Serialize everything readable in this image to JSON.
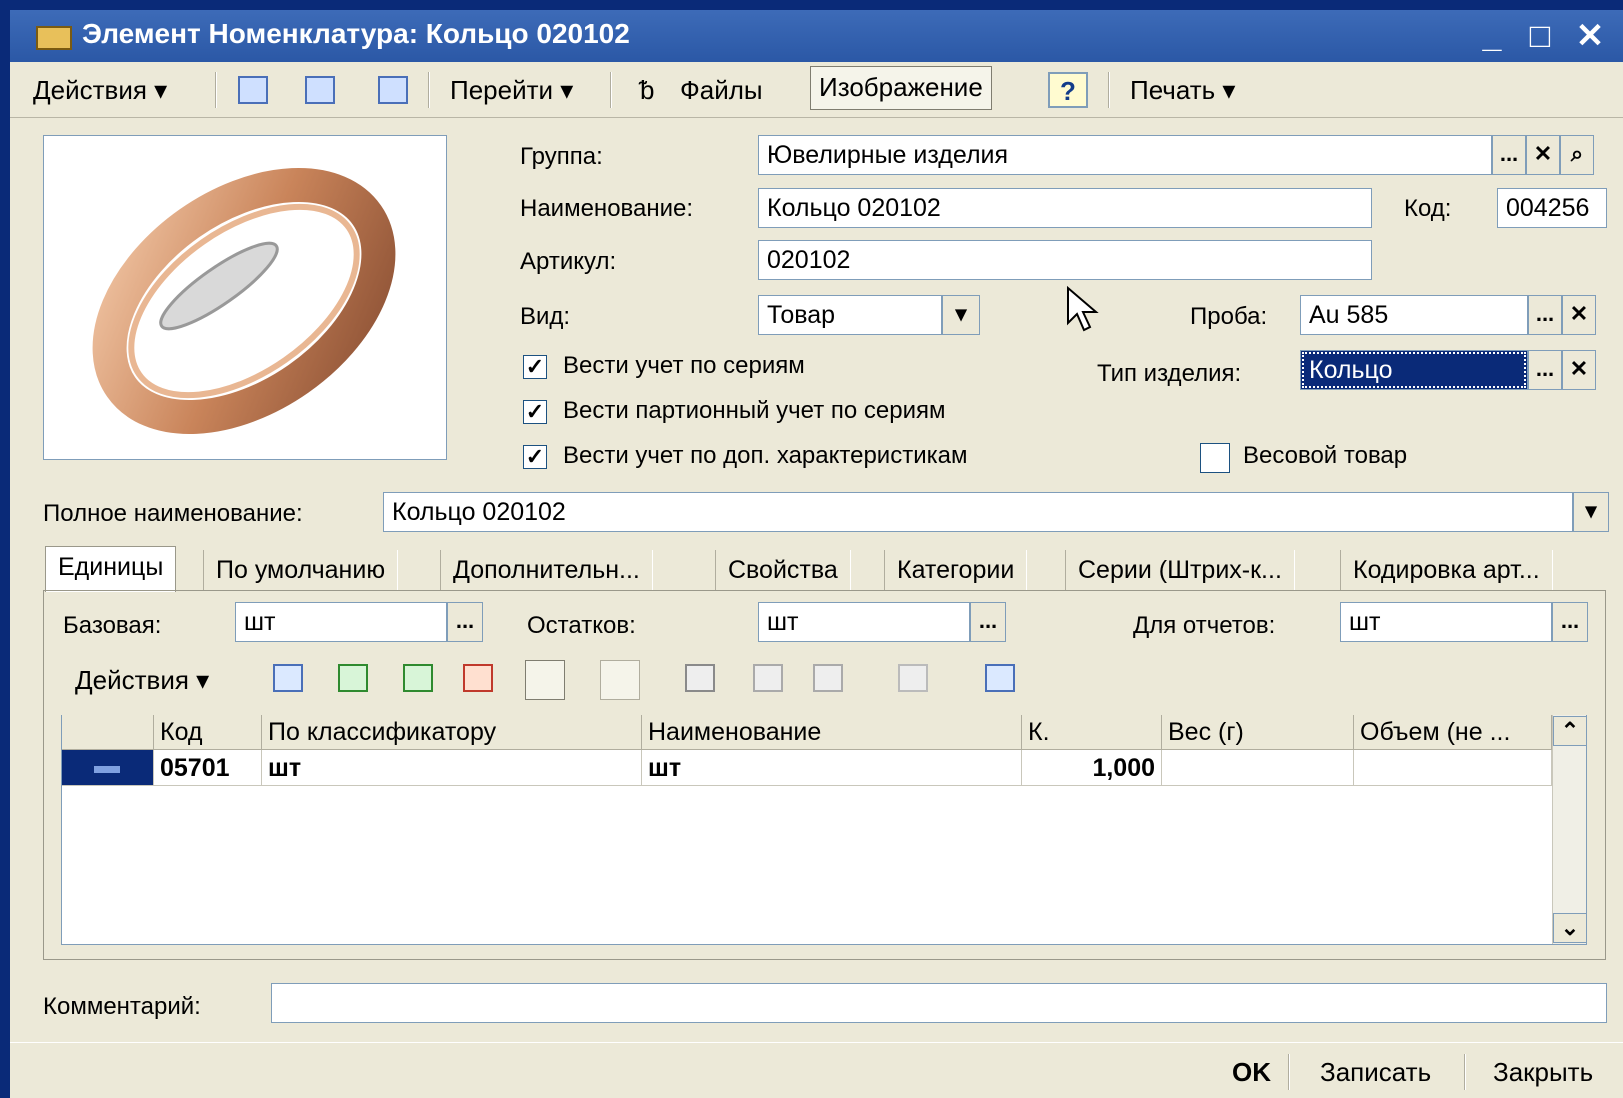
{
  "window": {
    "title": "Элемент Номенклатура: Кольцо 020102",
    "minimize": "_",
    "maximize": "□",
    "close": "✕"
  },
  "toolbar": {
    "actions": "Действия ▾",
    "goto": "Перейти ▾",
    "files": "Файлы",
    "image": "Изображение",
    "help": "?",
    "print": "Печать ▾"
  },
  "form": {
    "group_label": "Группа:",
    "group_value": "Ювелирные изделия",
    "name_label": "Наименование:",
    "name_value": "Кольцо 020102",
    "code_label": "Код:",
    "code_value": "004256",
    "article_label": "Артикул:",
    "article_value": "020102",
    "kind_label": "Вид:",
    "kind_value": "Товар",
    "assay_label": "Проба:",
    "assay_value": "Au 585",
    "product_type_label": "Тип изделия:",
    "product_type_value": "Кольцо",
    "cb_series": "Вести учет по сериям",
    "cb_batch_series": "Вести партионный учет по сериям",
    "cb_extra_chars": "Вести учет по доп.  характеристикам",
    "cb_weight": "Весовой товар",
    "fullname_label": "Полное наименование:",
    "fullname_value": "Кольцо 020102",
    "comment_label": "Комментарий:"
  },
  "tabs": [
    "Единицы",
    "По умолчанию",
    "Дополнительн...",
    "Свойства",
    "Категории",
    "Серии (Штрих-к...",
    "Кодировка арт..."
  ],
  "units": {
    "base_label": "Базовая:",
    "base_value": "шт",
    "rest_label": "Остатков:",
    "rest_value": "шт",
    "report_label": "Для отчетов:",
    "report_value": "шт",
    "actions": "Действия ▾"
  },
  "table": {
    "headers": [
      "Код",
      "По классификатору",
      "Наименование",
      "К.",
      "Вес (г)",
      "Объем (не ..."
    ],
    "rows": [
      {
        "code": "05701",
        "classifier": "шт",
        "name": "шт",
        "k": "1,000",
        "weight": "",
        "volume": ""
      }
    ]
  },
  "footer": {
    "ok": "OK",
    "save": "Записать",
    "close": "Закрыть"
  }
}
